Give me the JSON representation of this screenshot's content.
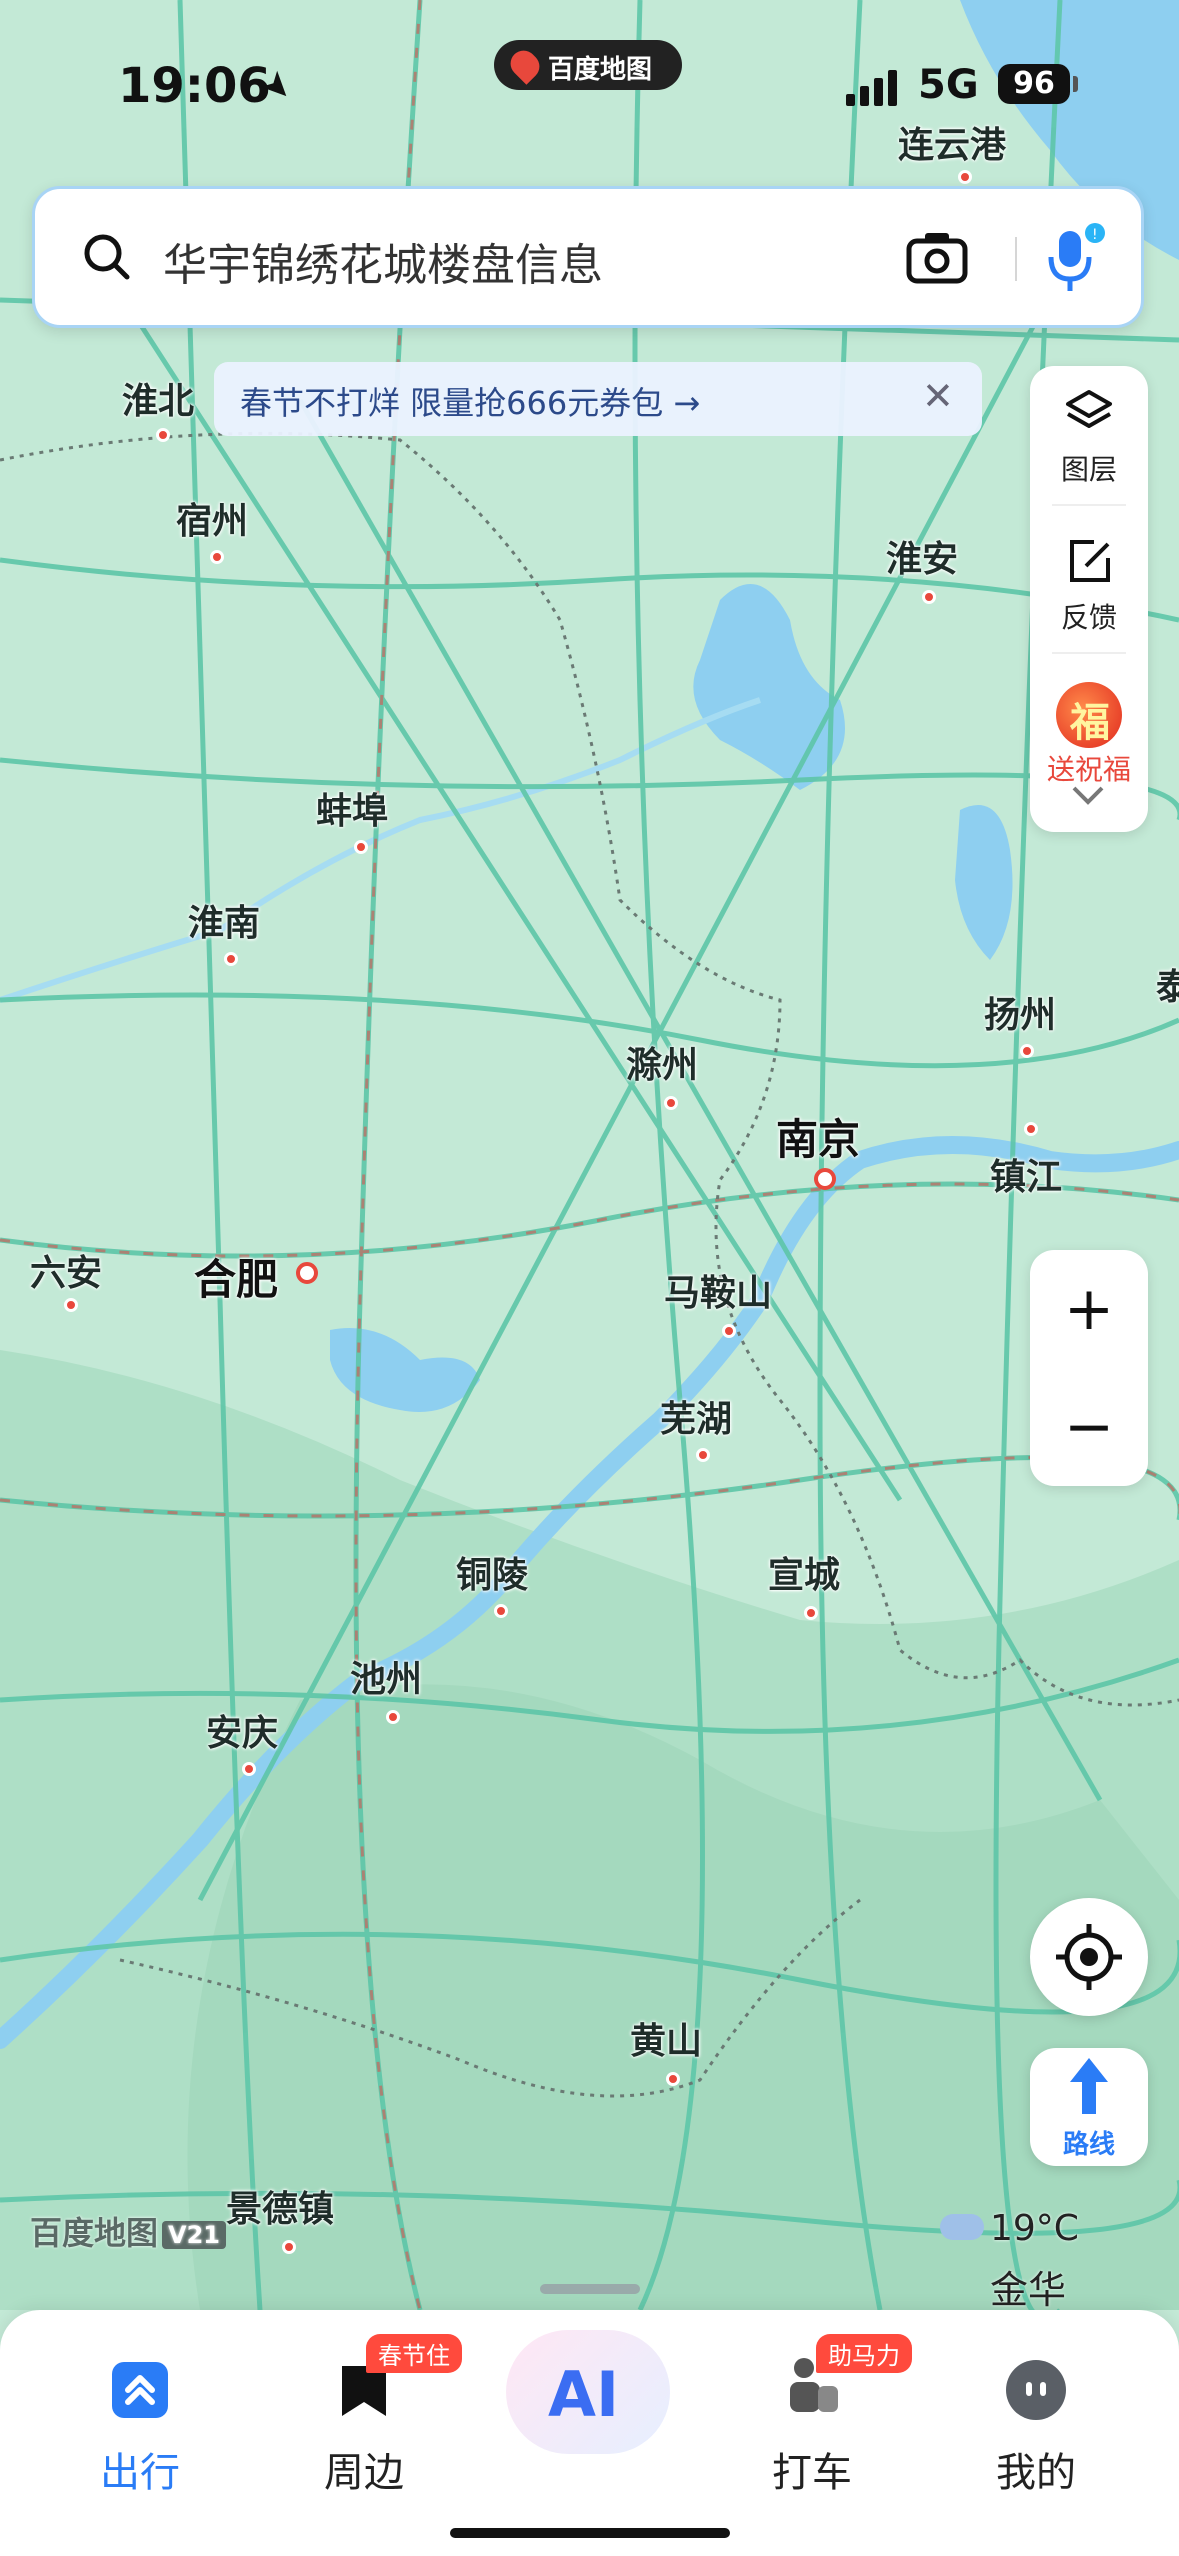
{
  "status_bar": {
    "time": "19:06",
    "app": "百度地图",
    "network": "5G",
    "battery": "96"
  },
  "search": {
    "placeholder": "华宇锦绣花城楼盘信息"
  },
  "promo": {
    "text": "春节不打烊 限量抢666元券包 →",
    "close": "✕"
  },
  "tools": {
    "layers": "图层",
    "feedback": "反馈",
    "fortune": "送祝福"
  },
  "zoom": {
    "in": "+",
    "out": "−"
  },
  "route": {
    "label": "路线"
  },
  "map": {
    "brand": "百度地图",
    "brand_version": "V21",
    "weather": {
      "temperature": "19°C",
      "city": "金华"
    },
    "cities": [
      {
        "name": "连云港"
      },
      {
        "name": "淮北"
      },
      {
        "name": "宿州"
      },
      {
        "name": "淮安"
      },
      {
        "name": "蚌埠"
      },
      {
        "name": "淮南"
      },
      {
        "name": "扬州"
      },
      {
        "name": "泰"
      },
      {
        "name": "滁州"
      },
      {
        "name": "南京"
      },
      {
        "name": "镇江"
      },
      {
        "name": "六安"
      },
      {
        "name": "合肥"
      },
      {
        "name": "马鞍山"
      },
      {
        "name": "芜湖"
      },
      {
        "name": "铜陵"
      },
      {
        "name": "宣城"
      },
      {
        "name": "池州"
      },
      {
        "name": "安庆"
      },
      {
        "name": "黄山"
      },
      {
        "name": "景德镇"
      }
    ]
  },
  "nav": {
    "items": [
      {
        "label": "出行",
        "badge": ""
      },
      {
        "label": "周边",
        "badge": "春节住"
      },
      {
        "label": "AI",
        "badge": ""
      },
      {
        "label": "打车",
        "badge": "助马力"
      },
      {
        "label": "我的",
        "badge": ""
      }
    ]
  },
  "colors": {
    "accent": "#2a7cf6",
    "land": "#bfe6d3",
    "water": "#8ecff0",
    "road": "#5ec6a8",
    "badge": "#ff4a3d"
  }
}
